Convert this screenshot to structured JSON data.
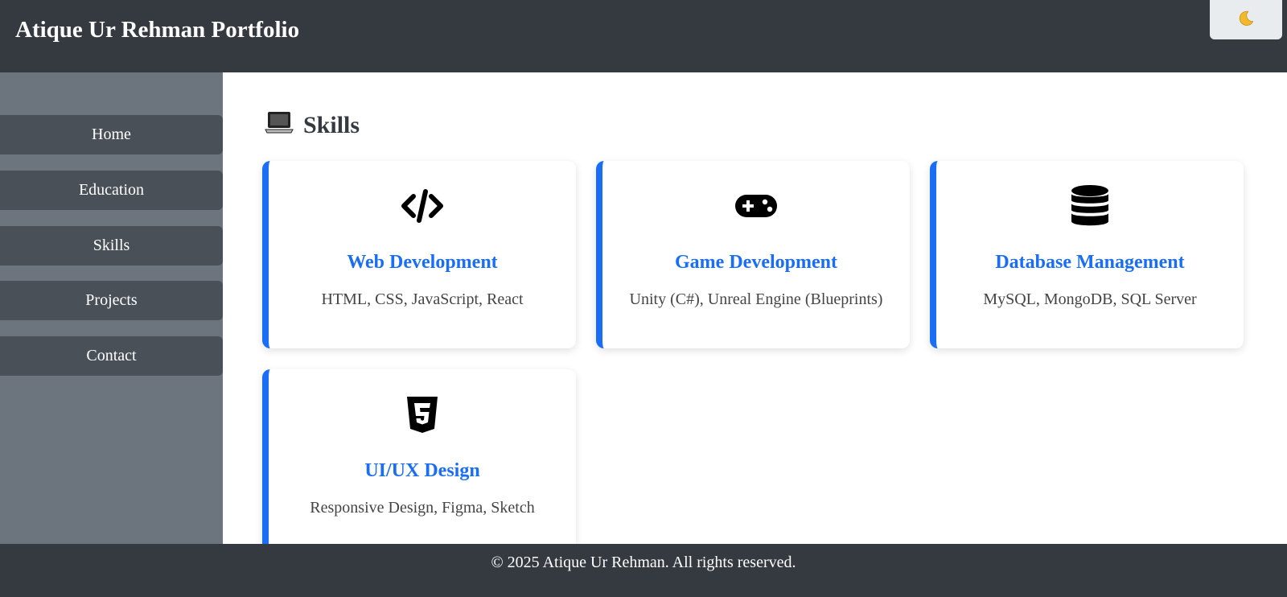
{
  "header": {
    "title": "Atique Ur Rehman Portfolio",
    "theme_toggle_icon": "moon-icon"
  },
  "sidebar": {
    "items": [
      {
        "label": "Home"
      },
      {
        "label": "Education"
      },
      {
        "label": "Skills"
      },
      {
        "label": "Projects"
      },
      {
        "label": "Contact"
      }
    ]
  },
  "main": {
    "section_icon": "laptop-icon",
    "section_title": "Skills",
    "cards": [
      {
        "icon": "code-icon",
        "title": "Web Development",
        "description": "HTML, CSS, JavaScript, React"
      },
      {
        "icon": "gamepad-icon",
        "title": "Game Development",
        "description": "Unity (C#), Unreal Engine (Blueprints)"
      },
      {
        "icon": "database-icon",
        "title": "Database Management",
        "description": "MySQL, MongoDB, SQL Server"
      },
      {
        "icon": "css3-icon",
        "title": "UI/UX Design",
        "description": "Responsive Design, Figma, Sketch"
      }
    ]
  },
  "footer": {
    "text": "© 2025 Atique Ur Rehman. All rights reserved."
  },
  "colors": {
    "header_bg": "#343a40",
    "sidebar_bg": "#6c757d",
    "nav_item_bg": "#495057",
    "accent": "#1a6ef5"
  }
}
